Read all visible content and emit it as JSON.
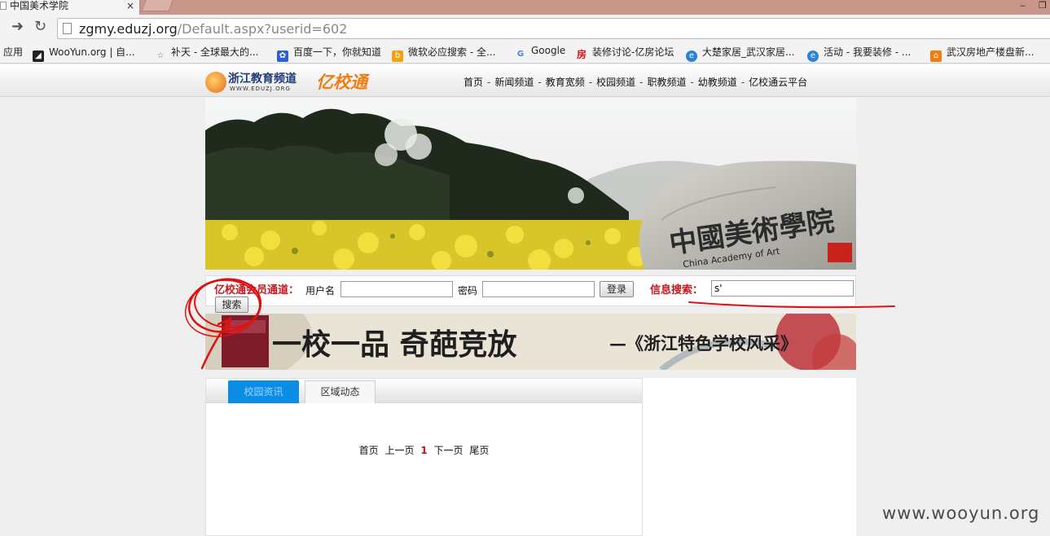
{
  "browser": {
    "tab_title": "中国美术学院",
    "tab_close": "×",
    "url_host": "zgmy.eduzj.org",
    "url_rest": "/Default.aspx?userid=602",
    "bookmarks": [
      {
        "label": "应用",
        "icon": "apps-icon"
      },
      {
        "label": "WooYun.org | 自...",
        "icon": "wooyun-icon"
      },
      {
        "label": "补天 - 全球最大的...",
        "icon": "butian-icon"
      },
      {
        "label": "百度一下，你就知道",
        "icon": "baidu-paw-icon"
      },
      {
        "label": "微软必应搜索 - 全...",
        "icon": "bing-icon"
      },
      {
        "label": "Google",
        "icon": "google-icon"
      },
      {
        "label": "装修讨论-亿房论坛",
        "icon": "fang-icon"
      },
      {
        "label": "大楚家居_武汉家居...",
        "icon": "ie-icon"
      },
      {
        "label": "活动 - 我要装修 - ...",
        "icon": "ie-icon"
      },
      {
        "label": "武汉房地产楼盘新...",
        "icon": "house-icon"
      }
    ]
  },
  "site": {
    "logo_main": "浙江教育频道",
    "logo_sub": "WWW.EDUZJ.ORG",
    "brand": "亿校通",
    "nav": [
      "首页",
      "新闻频道",
      "教育宽频",
      "校园频道",
      "职教频道",
      "幼教频道",
      "亿校通云平台"
    ],
    "nav_sep": "-"
  },
  "banner": {
    "stone_text": "中國美術學院",
    "stone_sub": "China Academy of Art"
  },
  "login": {
    "title": "亿校通会员通道：",
    "username_label": "用户名",
    "username_value": "",
    "password_label": "密码",
    "password_value": "",
    "login_button": "登录",
    "search_label": "信息搜索：",
    "search_value": "s'",
    "search_button": "搜索"
  },
  "ad": {
    "headline": "一校一品 奇葩竞放",
    "sub": "—《浙江特色学校风采》"
  },
  "news": {
    "tabs": [
      "校园资讯",
      "区域动态"
    ],
    "pager": {
      "first": "首页",
      "prev": "上一页",
      "current": "1",
      "next": "下一页",
      "last": "尾页"
    }
  },
  "watermark": "www.wooyun.org",
  "colors": {
    "accent_red": "#c8161d",
    "brand_orange": "#f07d11",
    "tab_active": "#0b8de5",
    "annotation_red": "#e01010"
  }
}
